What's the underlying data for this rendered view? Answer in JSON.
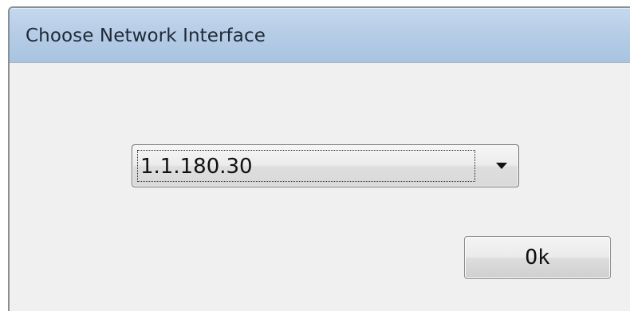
{
  "window": {
    "title": "Choose Network Interface"
  },
  "network_select": {
    "selected_value": "1.1.180.30",
    "dropdown_icon": "triangle-down"
  },
  "buttons": {
    "ok_label": "Ok"
  }
}
